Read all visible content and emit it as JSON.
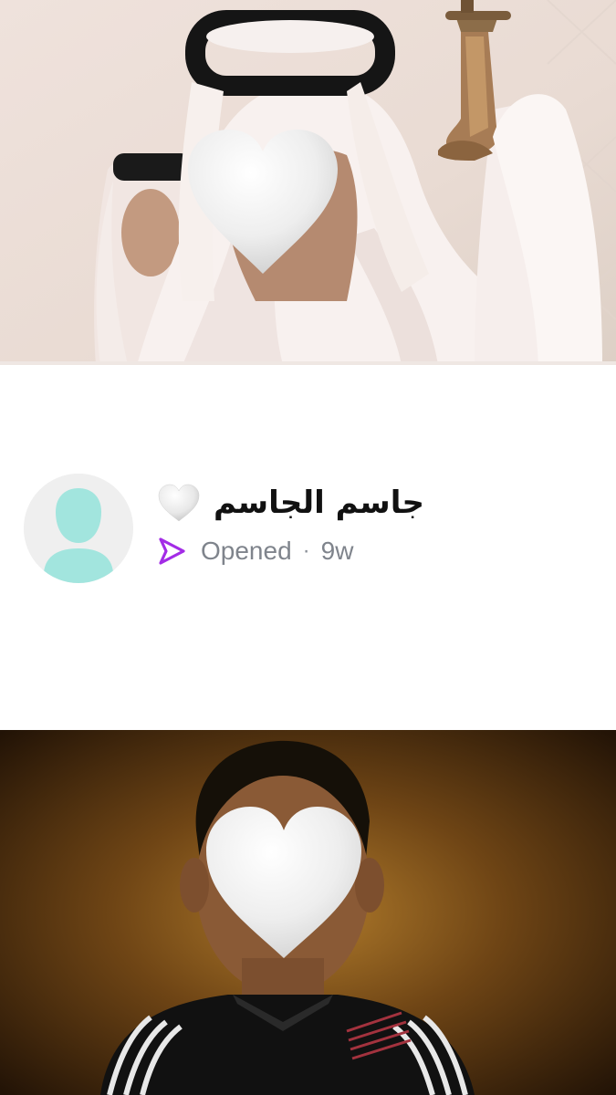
{
  "story": {
    "sender": {
      "name": "جاسم الجاسم",
      "emoji": "white-heart"
    },
    "status": {
      "icon": "sent-arrow-icon",
      "label": "Opened",
      "separator": "·",
      "age": "9w"
    }
  },
  "colors": {
    "accent": "#a32ce6",
    "avatar_figure": "#a2e5de",
    "avatar_bg": "#efefef",
    "status_text": "#7f848c"
  }
}
